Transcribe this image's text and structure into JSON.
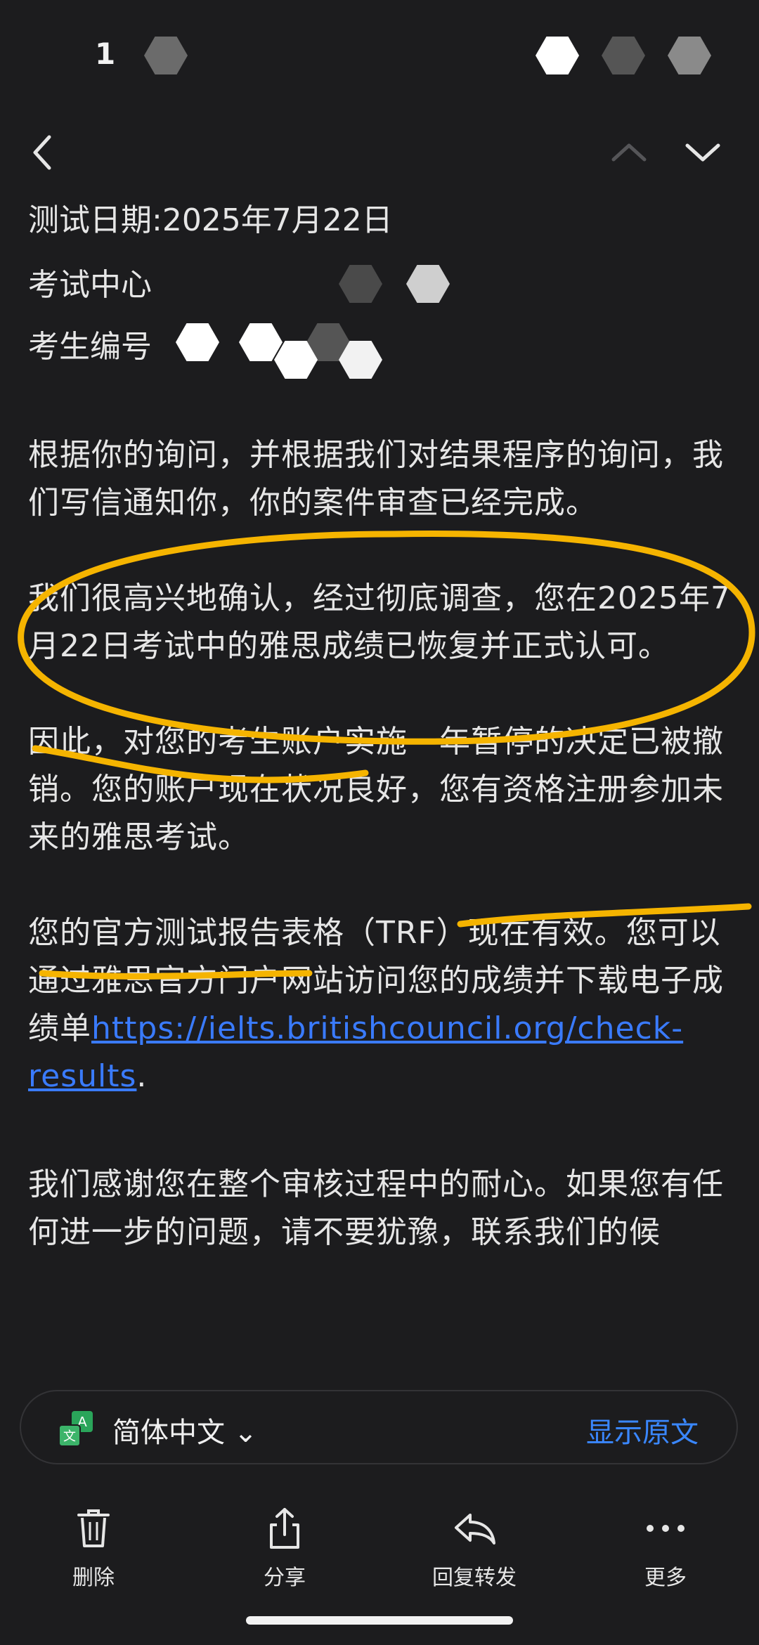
{
  "status": {
    "time": "1"
  },
  "email": {
    "test_date": "测试日期:2025年7月22日",
    "test_center": "考试中心",
    "candidate_no": "考生编号",
    "para1": "根据你的询问，并根据我们对结果程序的询问，我们写信通知你，你的案件审查已经完成。",
    "para2": "我们很高兴地确认，经过彻底调查，您在2025年7月22日考试中的雅思成绩已恢复并正式认可。",
    "para3": "因此，对您的考生账户实施一年暂停的决定已被撤销。您的账户现在状况良好，您有资格注册参加未来的雅思考试。",
    "para4_text": "您的官方测试报告表格（TRF）现在有效。您可以通过雅思官方门户网站访问您的成绩并下载电子成绩单",
    "para4_link": "https://ielts.britishcouncil.org/check-results",
    "para4_end": ".",
    "para5": "我们感谢您在整个审核过程中的耐心。如果您有任何进一步的问题，请不要犹豫，联系我们的候"
  },
  "translate": {
    "lang": "简体中文 ⌄",
    "show_original": "显示原文"
  },
  "toolbar": {
    "delete": "删除",
    "share": "分享",
    "reply": "回复转发",
    "more": "更多"
  },
  "colors": {
    "background": "#1c1c1e",
    "accent": "#3a7bff",
    "highlight": "#f5b400"
  }
}
